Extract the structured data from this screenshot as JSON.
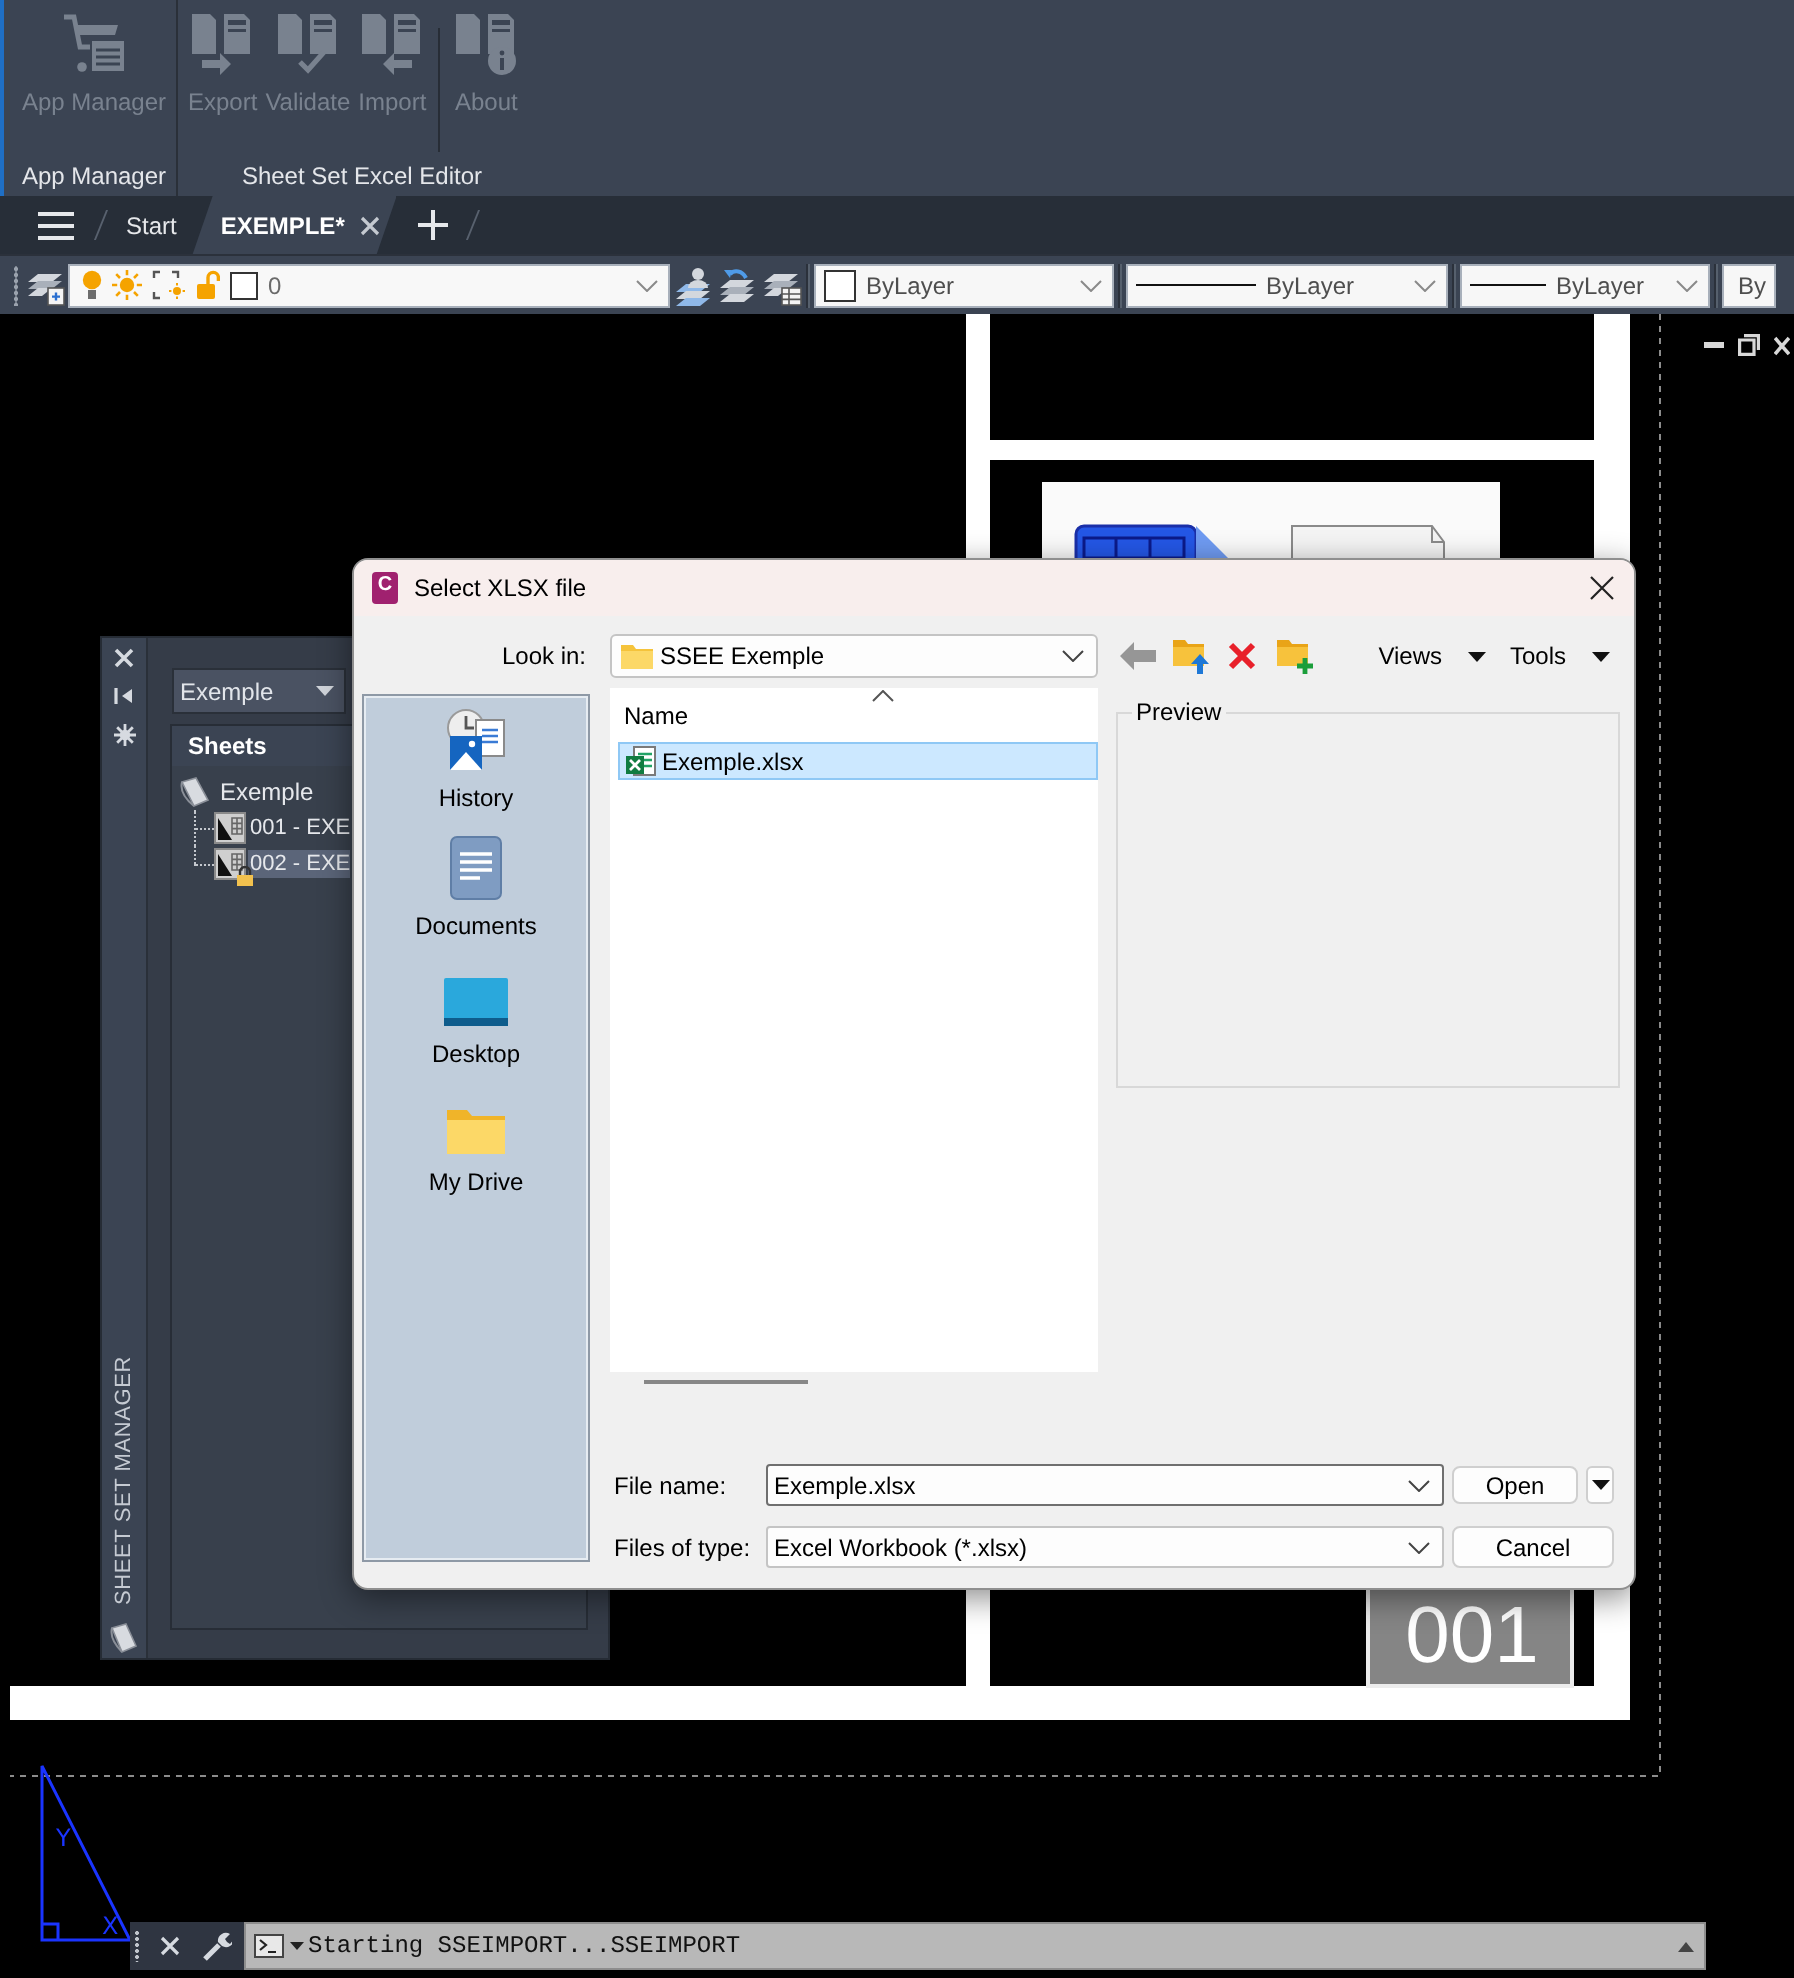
{
  "ribbon": {
    "panels": [
      {
        "title": "App Manager",
        "groups": [
          {
            "buttons": [
              {
                "label": "App Manager",
                "kind": "cart",
                "disabled": true
              }
            ]
          }
        ]
      },
      {
        "title": "Sheet Set Excel Editor",
        "groups": [
          {
            "buttons": [
              {
                "label": "Export",
                "kind": "export",
                "disabled": true
              },
              {
                "label": "Validate",
                "kind": "validate",
                "disabled": true
              },
              {
                "label": "Import",
                "kind": "import",
                "disabled": true
              }
            ]
          },
          {
            "buttons": [
              {
                "label": "About",
                "kind": "about",
                "disabled": true
              }
            ]
          }
        ]
      }
    ]
  },
  "file_tabs": [
    {
      "label": "Start",
      "selected": false
    },
    {
      "label": "EXEMPLE*",
      "selected": true
    }
  ],
  "properties_toolbar": {
    "layer": {
      "name": "0",
      "on": true,
      "frozen": false,
      "locked": false
    },
    "combos": [
      {
        "kind": "color",
        "value": "ByLayer"
      },
      {
        "kind": "linetype",
        "value": "ByLayer"
      },
      {
        "kind": "lineweight",
        "value": "ByLayer"
      },
      {
        "kind": "plotstyle",
        "value": "By"
      }
    ]
  },
  "drawing": {
    "sheet_number": "001",
    "ucs": {
      "y_label": "Y",
      "x_label": "X"
    }
  },
  "sheet_set_manager": {
    "title": "SHEET SET MANAGER",
    "sheet_set": "Exemple",
    "tab": "Sheets",
    "tree": [
      {
        "label": "Exemple",
        "kind": "sheet-set",
        "selected": false,
        "children": [
          {
            "label": "001 - EXE",
            "kind": "sheet",
            "locked": false,
            "selected": false
          },
          {
            "label": "002 - EXE",
            "kind": "sheet",
            "locked": true,
            "selected": true
          }
        ]
      }
    ]
  },
  "dialog": {
    "logo_letter": "C",
    "title": "Select XLSX file",
    "look_in": {
      "label": "Look in:",
      "value": "SSEE Exemple"
    },
    "nav_buttons": [
      {
        "kind": "back",
        "disabled": true
      },
      {
        "kind": "up-folder",
        "disabled": false
      },
      {
        "kind": "delete",
        "disabled": false
      },
      {
        "kind": "new-folder",
        "disabled": false
      }
    ],
    "menus": [
      "Views",
      "Tools"
    ],
    "places": [
      {
        "label": "History",
        "kind": "history"
      },
      {
        "label": "Documents",
        "kind": "documents"
      },
      {
        "label": "Desktop",
        "kind": "desktop"
      },
      {
        "label": "My Drive",
        "kind": "folder"
      }
    ],
    "file_list": {
      "column": "Name",
      "files": [
        {
          "name": "Exemple.xlsx",
          "selected": true
        }
      ]
    },
    "preview": {
      "label": "Preview"
    },
    "file_name": {
      "label": "File name:",
      "value": "Exemple.xlsx"
    },
    "file_type": {
      "label": "Files of type:",
      "value": "Excel Workbook (*.xlsx)"
    },
    "buttons": [
      {
        "label": "Open",
        "kind": "split"
      },
      {
        "label": "Cancel",
        "kind": "plain"
      }
    ]
  },
  "command_line": {
    "text": "Starting SSEIMPORT...SSEIMPORT"
  }
}
